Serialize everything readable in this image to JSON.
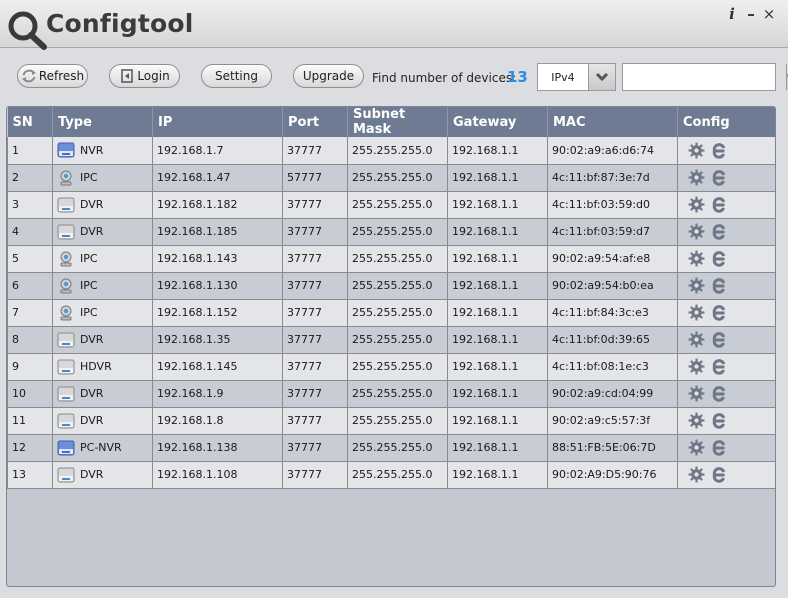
{
  "app": {
    "title": "Configtool",
    "window_buttons": {
      "info": "i",
      "minimize": "–",
      "close": "×"
    }
  },
  "toolbar": {
    "refresh_label": "Refresh",
    "login_label": "Login",
    "setting_label": "Setting",
    "upgrade_label": "Upgrade",
    "find_label": "Find number of devices:",
    "device_count": "13",
    "ip_version": "IPv4",
    "search_value": "",
    "search_placeholder": ""
  },
  "colors": {
    "accent": "#2f8ce3",
    "header_bg": "#6f7b93",
    "row_odd": "#e4e5e8",
    "row_even": "#c8ccd5"
  },
  "table": {
    "columns": [
      "SN",
      "Type",
      "IP",
      "Port",
      "Subnet Mask",
      "Gateway",
      "MAC",
      "Config"
    ],
    "rows": [
      {
        "sn": "1",
        "type": "NVR",
        "icon": "nvr-icon",
        "ip": "192.168.1.7",
        "port": "37777",
        "mask": "255.255.255.0",
        "gateway": "192.168.1.1",
        "mac": "90:02:a9:a6:d6:74"
      },
      {
        "sn": "2",
        "type": "IPC",
        "icon": "ipc-camera-icon",
        "ip": "192.168.1.47",
        "port": "57777",
        "mask": "255.255.255.0",
        "gateway": "192.168.1.1",
        "mac": "4c:11:bf:87:3e:7d"
      },
      {
        "sn": "3",
        "type": "DVR",
        "icon": "dvr-icon",
        "ip": "192.168.1.182",
        "port": "37777",
        "mask": "255.255.255.0",
        "gateway": "192.168.1.1",
        "mac": "4c:11:bf:03:59:d0"
      },
      {
        "sn": "4",
        "type": "DVR",
        "icon": "dvr-icon",
        "ip": "192.168.1.185",
        "port": "37777",
        "mask": "255.255.255.0",
        "gateway": "192.168.1.1",
        "mac": "4c:11:bf:03:59:d7"
      },
      {
        "sn": "5",
        "type": "IPC",
        "icon": "ipc-camera-icon",
        "ip": "192.168.1.143",
        "port": "37777",
        "mask": "255.255.255.0",
        "gateway": "192.168.1.1",
        "mac": "90:02:a9:54:af:e8"
      },
      {
        "sn": "6",
        "type": "IPC",
        "icon": "ipc-camera-icon",
        "ip": "192.168.1.130",
        "port": "37777",
        "mask": "255.255.255.0",
        "gateway": "192.168.1.1",
        "mac": "90:02:a9:54:b0:ea"
      },
      {
        "sn": "7",
        "type": "IPC",
        "icon": "ipc-camera-icon",
        "ip": "192.168.1.152",
        "port": "37777",
        "mask": "255.255.255.0",
        "gateway": "192.168.1.1",
        "mac": "4c:11:bf:84:3c:e3"
      },
      {
        "sn": "8",
        "type": "DVR",
        "icon": "dvr-icon",
        "ip": "192.168.1.35",
        "port": "37777",
        "mask": "255.255.255.0",
        "gateway": "192.168.1.1",
        "mac": "4c:11:bf:0d:39:65"
      },
      {
        "sn": "9",
        "type": "HDVR",
        "icon": "dvr-icon",
        "ip": "192.168.1.145",
        "port": "37777",
        "mask": "255.255.255.0",
        "gateway": "192.168.1.1",
        "mac": "4c:11:bf:08:1e:c3"
      },
      {
        "sn": "10",
        "type": "DVR",
        "icon": "dvr-icon",
        "ip": "192.168.1.9",
        "port": "37777",
        "mask": "255.255.255.0",
        "gateway": "192.168.1.1",
        "mac": "90:02:a9:cd:04:99"
      },
      {
        "sn": "11",
        "type": "DVR",
        "icon": "dvr-icon",
        "ip": "192.168.1.8",
        "port": "37777",
        "mask": "255.255.255.0",
        "gateway": "192.168.1.1",
        "mac": "90:02:a9:c5:57:3f"
      },
      {
        "sn": "12",
        "type": "PC-NVR",
        "icon": "nvr-icon",
        "ip": "192.168.1.138",
        "port": "37777",
        "mask": "255.255.255.0",
        "gateway": "192.168.1.1",
        "mac": "88:51:FB:5E:06:7D"
      },
      {
        "sn": "13",
        "type": "DVR",
        "icon": "dvr-icon",
        "ip": "192.168.1.108",
        "port": "37777",
        "mask": "255.255.255.0",
        "gateway": "192.168.1.1",
        "mac": "90:02:A9:D5:90:76"
      }
    ]
  }
}
